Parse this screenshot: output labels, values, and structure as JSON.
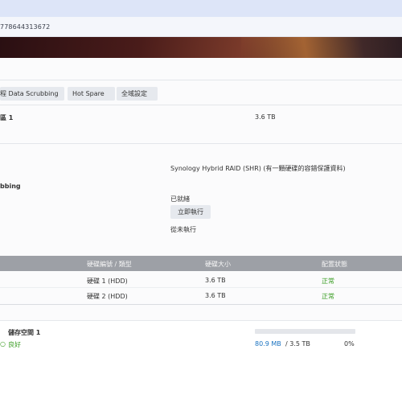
{
  "url": "778644313672",
  "tabs": [
    {
      "label": "程 Data Scrubbing"
    },
    {
      "label": "Hot Spare"
    },
    {
      "label": "全域設定"
    }
  ],
  "pool": {
    "title": "區 1",
    "size": "3.6 TB"
  },
  "details": {
    "raid_type": "Synology Hybrid RAID (SHR) (有一顆硬碟的容錯保護資料)",
    "scrubbing_label": "bbing",
    "scrub_status": "已就緒",
    "run_now_label": "立即執行",
    "last_run": "從未執行"
  },
  "drives_table": {
    "headers": [
      "硬碟編號 / 類型",
      "硬碟大小",
      "配置狀態"
    ],
    "rows": [
      {
        "drive": "硬碟 1 (HDD)",
        "size": "3.6 TB",
        "status": "正常"
      },
      {
        "drive": "硬碟 2 (HDD)",
        "size": "3.6 TB",
        "status": "正常"
      }
    ]
  },
  "volume": {
    "name": "儲存空間 1",
    "status": "良好",
    "used": "80.9 MB",
    "separator": "/ 3.5 TB",
    "percent": "0%",
    "usage_fraction": 0.0
  },
  "colors": {
    "ok_green": "#3a9d23",
    "link_blue": "#1a73c1",
    "table_header": "#9da0a6"
  }
}
